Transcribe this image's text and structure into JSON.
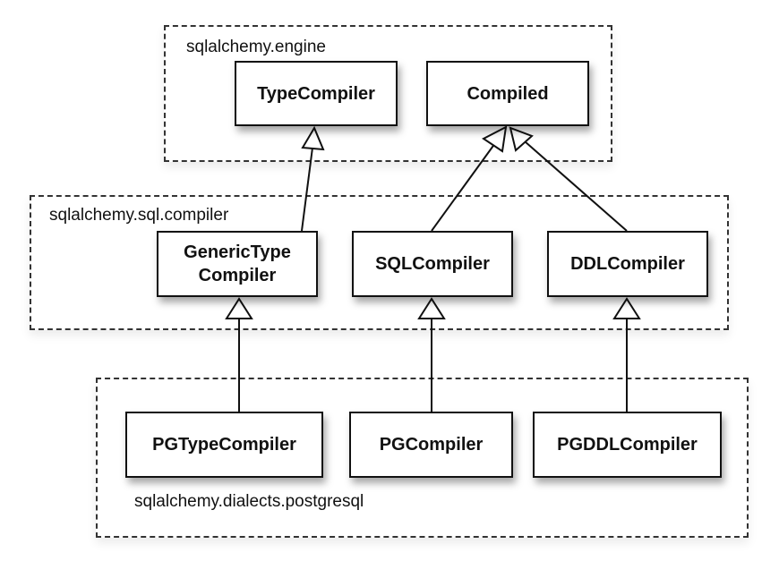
{
  "packages": {
    "engine": "sqlalchemy.engine",
    "compiler": "sqlalchemy.sql.compiler",
    "postgresql": "sqlalchemy.dialects.postgresql"
  },
  "classes": {
    "type_compiler": "TypeCompiler",
    "compiled": "Compiled",
    "generic_type_compiler_line1": "GenericType",
    "generic_type_compiler_line2": "Compiler",
    "sql_compiler": "SQLCompiler",
    "ddl_compiler": "DDLCompiler",
    "pg_type_compiler": "PGTypeCompiler",
    "pg_compiler": "PGCompiler",
    "pg_ddl_compiler": "PGDDLCompiler"
  },
  "relations": [
    {
      "child": "GenericTypeCompiler",
      "parent": "TypeCompiler",
      "type": "inheritance"
    },
    {
      "child": "SQLCompiler",
      "parent": "Compiled",
      "type": "inheritance"
    },
    {
      "child": "DDLCompiler",
      "parent": "Compiled",
      "type": "inheritance"
    },
    {
      "child": "PGTypeCompiler",
      "parent": "GenericTypeCompiler",
      "type": "inheritance"
    },
    {
      "child": "PGCompiler",
      "parent": "SQLCompiler",
      "type": "inheritance"
    },
    {
      "child": "PGDDLCompiler",
      "parent": "DDLCompiler",
      "type": "inheritance"
    }
  ]
}
